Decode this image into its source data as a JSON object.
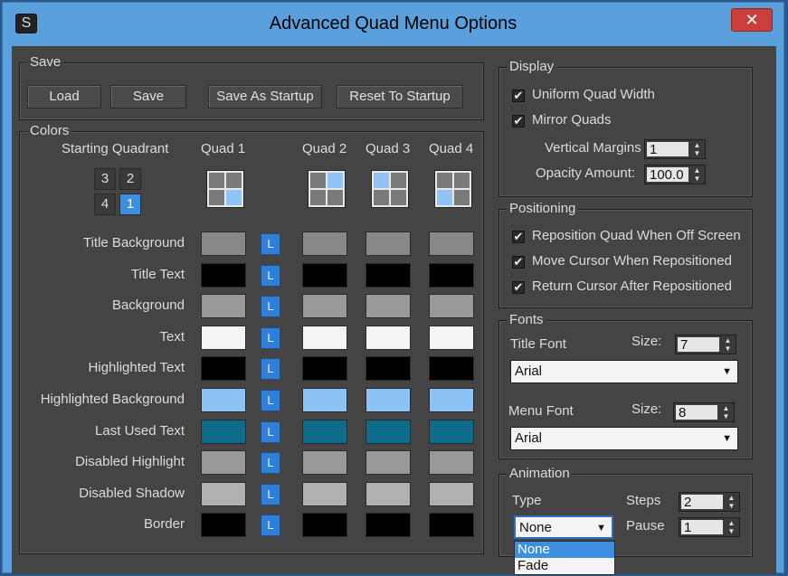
{
  "window": {
    "title": "Advanced Quad Menu Options",
    "close_glyph": "✕",
    "app_icon": "S"
  },
  "save_group": {
    "legend": "Save",
    "buttons": {
      "load": "Load",
      "save": "Save",
      "save_as_startup": "Save As Startup",
      "reset_to_startup": "Reset To Startup"
    }
  },
  "colors_group": {
    "legend": "Colors",
    "starting_quadrant_label": "Starting Quadrant",
    "quad_headers": [
      "Quad 1",
      "Quad 2",
      "Quad 3",
      "Quad 4"
    ],
    "quadrant_numbers": {
      "q3": "3",
      "q2": "2",
      "q4": "4",
      "q1": "1"
    },
    "active_quadrant": "1",
    "lock_label": "L",
    "rows": [
      {
        "label": "Title Background",
        "colors": [
          "#888888",
          "#888888",
          "#888888",
          "#888888"
        ]
      },
      {
        "label": "Title Text",
        "colors": [
          "#000000",
          "#000000",
          "#000000",
          "#000000"
        ]
      },
      {
        "label": "Background",
        "colors": [
          "#999999",
          "#999999",
          "#999999",
          "#999999"
        ]
      },
      {
        "label": "Text",
        "colors": [
          "#f4f4f4",
          "#f4f4f4",
          "#f4f4f4",
          "#f4f4f4"
        ]
      },
      {
        "label": "Highlighted Text",
        "colors": [
          "#000000",
          "#000000",
          "#000000",
          "#000000"
        ]
      },
      {
        "label": "Highlighted Background",
        "colors": [
          "#8cc2f4",
          "#8cc2f4",
          "#8cc2f4",
          "#8cc2f4"
        ]
      },
      {
        "label": "Last Used Text",
        "colors": [
          "#0d6b8c",
          "#0d6b8c",
          "#0d6b8c",
          "#0d6b8c"
        ]
      },
      {
        "label": "Disabled Highlight",
        "colors": [
          "#999999",
          "#999999",
          "#999999",
          "#999999"
        ]
      },
      {
        "label": "Disabled Shadow",
        "colors": [
          "#b0b0b0",
          "#b0b0b0",
          "#b0b0b0",
          "#b0b0b0"
        ]
      },
      {
        "label": "Border",
        "colors": [
          "#000000",
          "#000000",
          "#000000",
          "#000000"
        ]
      }
    ]
  },
  "display_group": {
    "legend": "Display",
    "uniform_quad_width": {
      "label": "Uniform Quad Width",
      "checked": true
    },
    "mirror_quads": {
      "label": "Mirror Quads",
      "checked": true
    },
    "vertical_margins": {
      "label": "Vertical Margins",
      "value": "1"
    },
    "opacity_amount": {
      "label": "Opacity Amount:",
      "value": "100.0"
    }
  },
  "positioning_group": {
    "legend": "Positioning",
    "reposition_quad": {
      "label": "Reposition Quad When Off Screen",
      "checked": true
    },
    "move_cursor": {
      "label": "Move Cursor When Repositioned",
      "checked": true
    },
    "return_cursor": {
      "label": "Return Cursor After Repositioned",
      "checked": true
    }
  },
  "fonts_group": {
    "legend": "Fonts",
    "title_font": {
      "label": "Title Font",
      "size_label": "Size:",
      "size": "7",
      "font": "Arial"
    },
    "menu_font": {
      "label": "Menu Font",
      "size_label": "Size:",
      "size": "8",
      "font": "Arial"
    }
  },
  "animation_group": {
    "legend": "Animation",
    "type_label": "Type",
    "type_value": "None",
    "type_options": [
      "None",
      "Fade"
    ],
    "steps_label": "Steps",
    "steps_value": "2",
    "pause_label": "Pause",
    "pause_value": "1"
  },
  "glyphs": {
    "check": "✔",
    "spin_up": "▲",
    "spin_down": "▼",
    "dropdown": "▼"
  }
}
